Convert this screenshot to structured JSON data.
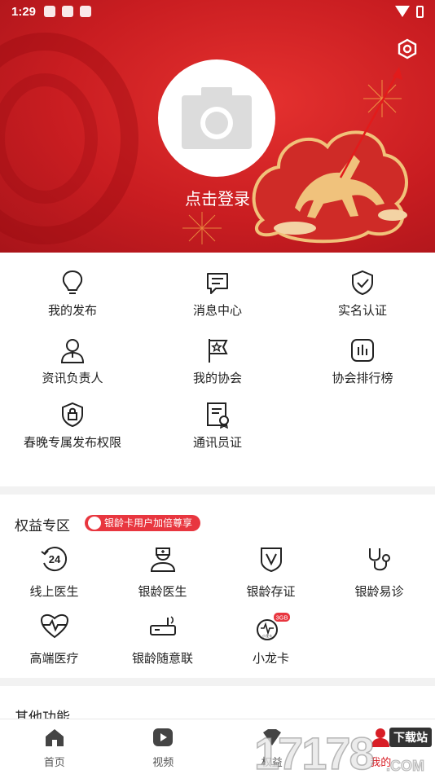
{
  "status_bar": {
    "time": "1:29"
  },
  "header": {
    "login_label": "点击登录"
  },
  "menu": {
    "items": [
      {
        "label": "我的发布",
        "icon": "lightbulb-icon"
      },
      {
        "label": "消息中心",
        "icon": "message-icon"
      },
      {
        "label": "实名认证",
        "icon": "shield-check-icon"
      },
      {
        "label": "资讯负责人",
        "icon": "person-icon"
      },
      {
        "label": "我的协会",
        "icon": "flag-star-icon"
      },
      {
        "label": "协会排行榜",
        "icon": "bar-chart-icon"
      },
      {
        "label": "春晚专属发布权限",
        "icon": "shield-lock-icon"
      },
      {
        "label": "通讯员证",
        "icon": "certificate-icon"
      }
    ]
  },
  "benefits": {
    "title": "权益专区",
    "badge": "银龄卡用户加倍尊享",
    "items": [
      {
        "label": "线上医生",
        "icon": "24h-icon"
      },
      {
        "label": "银龄医生",
        "icon": "doctor-icon"
      },
      {
        "label": "银龄存证",
        "icon": "shield-v-icon"
      },
      {
        "label": "银龄易诊",
        "icon": "stethoscope-icon"
      },
      {
        "label": "高端医疗",
        "icon": "heart-pulse-icon"
      },
      {
        "label": "银龄随意联",
        "icon": "router-icon"
      },
      {
        "label": "小龙卡",
        "icon": "sim-card-icon",
        "tag": "3GB",
        "sub": "小龙卡"
      }
    ]
  },
  "other": {
    "title": "其他功能"
  },
  "tabbar": {
    "tabs": [
      {
        "label": "首页",
        "icon": "home-icon"
      },
      {
        "label": "视频",
        "icon": "play-icon"
      },
      {
        "label": "权益",
        "icon": "crown-icon"
      },
      {
        "label": "我的",
        "icon": "user-icon"
      }
    ]
  },
  "watermark": {
    "text": "17178",
    "sub": ".COM",
    "site": "下载站"
  },
  "colors": {
    "accent": "#d81e26",
    "header_bg": "#c91d21"
  }
}
